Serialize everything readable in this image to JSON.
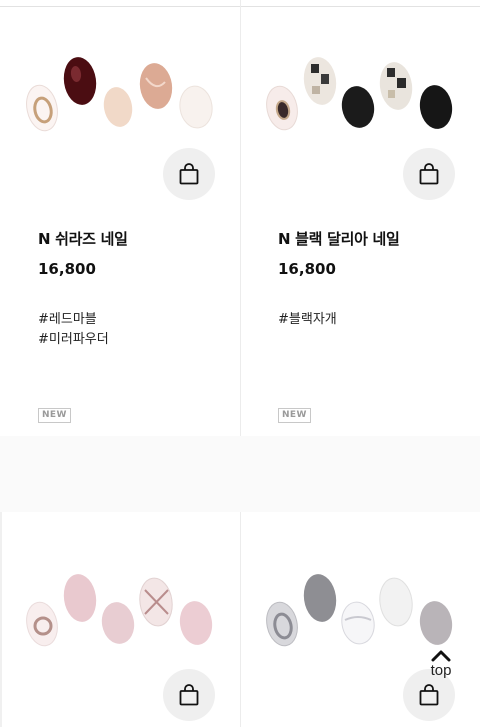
{
  "products": [
    {
      "name": "N 쉬라즈 네일",
      "price": "16,800",
      "tags": [
        "#레드마블",
        "#미러파우더"
      ],
      "badge": "NEW",
      "thumbnail": "nail-set-shiraz"
    },
    {
      "name": "N 블랙 달리아 네일",
      "price": "16,800",
      "tags": [
        "#블랙자개"
      ],
      "badge": "NEW",
      "thumbnail": "nail-set-black-dahlia"
    },
    {
      "thumbnail": "nail-set-pink-check"
    },
    {
      "thumbnail": "nail-set-silver-mirror"
    }
  ],
  "top_button": {
    "label": "top",
    "icon": "chevron-up-icon"
  },
  "cart_icon": "shopping-bag-icon"
}
